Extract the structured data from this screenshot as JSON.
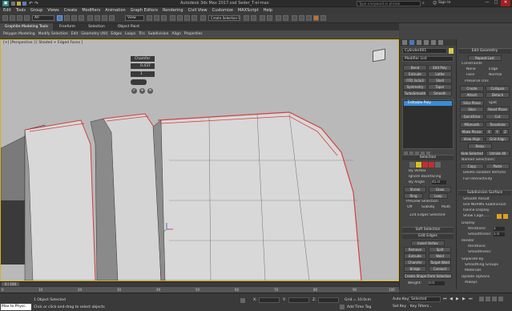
{
  "title": {
    "text": "Autodesk 3ds Max 2017.xsd   Seder_T-el-max",
    "search_placeholder": "Type a keyword or phrase",
    "sign_in": "Sign In"
  },
  "menu": [
    "Edit",
    "Tools",
    "Group",
    "Views",
    "Create",
    "Modifiers",
    "Animation",
    "Graph Editors",
    "Rendering",
    "Civil View",
    "Customize",
    "MAXScript",
    "Help"
  ],
  "toolbar": {
    "select_filter": "All",
    "view": "View",
    "selection_set": "Create Selection Se"
  },
  "ribbon_tabs": [
    "Graphite Modeling Tools",
    "Freeform",
    "Selection",
    "Object Paint"
  ],
  "ribbon_panels": [
    "Polygon Modeling",
    "Modify Selection",
    "Edit",
    "Geometry (All)",
    "Edges",
    "Loops",
    "Tris",
    "Subdivision",
    "Align",
    "Properties"
  ],
  "viewport": {
    "label": "[+] [Perspective ] [ Shaded + Edged Faces ]"
  },
  "chamfer": {
    "title": "Chamfer",
    "amount": "0.437",
    "segments": "1"
  },
  "command_panel": {
    "object_name": "Cylinder001",
    "modifier_list": "Modifier List",
    "buttons": [
      [
        "Bend",
        "Edit Poly"
      ],
      [
        "Extrude",
        "Lathe"
      ],
      [
        "FFD 3x3x3",
        "Shell"
      ],
      [
        "Symmetry",
        "Taper"
      ],
      [
        "TurboSmooth",
        "Smooth"
      ]
    ],
    "stack_item": "Editable Poly"
  },
  "selection": {
    "title": "Selection",
    "by_vertex": "By Vertex",
    "ignore_backfacing": "Ignore Backfacing",
    "by_angle": "By Angle",
    "angle": "45.0",
    "shrink": "Shrink",
    "grow": "Grow",
    "ring": "Ring",
    "loop": "Loop",
    "preview": "Preview Selection",
    "off": "Off",
    "subobj": "SubObj",
    "multi": "Multi",
    "status": "224 Edges Selected"
  },
  "soft_selection": "Soft Selection",
  "edit_edges": {
    "title": "Edit Edges",
    "insert_vertex": "Insert Vertex",
    "remove": "Remove",
    "split": "Split",
    "extrude": "Extrude",
    "weld": "Weld",
    "chamfer": "Chamfer",
    "target_weld": "Target Weld",
    "bridge": "Bridge",
    "connect": "Connect",
    "create_shape": "Create Shape From Selection",
    "weight": "Weight:",
    "weight_val": "0.0",
    "crease": "Crease:",
    "crease_val": "0.0"
  },
  "edit_geometry": {
    "title": "Edit Geometry",
    "repeat_last": "Repeat Last",
    "constraints": "Constraints",
    "none": "None",
    "edge": "Edge",
    "face": "Face",
    "normal": "Normal",
    "preserve_uvs": "Preserve UVs",
    "create": "Create",
    "collapse": "Collapse",
    "attach": "Attach",
    "detach": "Detach",
    "slice_plane": "Slice Plane",
    "split": "Split",
    "slice": "Slice",
    "reset_plane": "Reset Plane",
    "quickslice": "QuickSlice",
    "cut": "Cut",
    "msmooth": "MSmooth",
    "tessellate": "Tessellate",
    "make_planar": "Make Planar",
    "x": "X",
    "y": "Y",
    "z": "Z",
    "view_align": "View Align",
    "grid_align": "Grid Align",
    "relax": "Relax",
    "hide_selected": "Hide Selected",
    "unhide_all": "Unhide All",
    "named_selections": "Named Selections:",
    "copy": "Copy",
    "paste": "Paste",
    "delete_isolated": "Delete Isolated Vertices",
    "full_interactivity": "Full Interactivity"
  },
  "subdivision": {
    "title": "Subdivision Surface",
    "smooth_result": "Smooth Result",
    "use_nurms": "Use NURMS Subdivision",
    "isoline": "Isoline Display",
    "show_cage": "Show Cage......",
    "display": "Display",
    "iterations": "Iterations:",
    "iter_val": "1",
    "smoothness": "Smoothness:",
    "smooth_val": "1.0",
    "render": "Render",
    "separate_by": "Separate By",
    "smoothing_groups": "Smoothing Groups",
    "materials": "Materials",
    "update_options": "Update Options",
    "always": "Always",
    "when_rendering": "When Rendering",
    "manually": "Manually",
    "update": "Update"
  },
  "timeline": {
    "frame": "0 / 100",
    "ticks": [
      "0",
      "10",
      "20",
      "30",
      "40",
      "50",
      "60",
      "70",
      "80",
      "90",
      "100"
    ]
  },
  "status": {
    "maxscript": "Max to Physc.",
    "selected": "1 Object Selected",
    "prompt": "Click or click-and-drag to select objects",
    "x": "X:",
    "y": "Y:",
    "z": "Z:",
    "grid": "Grid = 10.0cm",
    "add_time_tag": "Add Time Tag",
    "auto_key": "Auto Key",
    "set_key": "Set Key",
    "selected_dd": "Selected",
    "key_filters": "Key Filters..."
  },
  "colors": {
    "accent": "#3b8cd6",
    "edge_selected": "#e04040",
    "viewport_bg": "#b9b9b9"
  }
}
